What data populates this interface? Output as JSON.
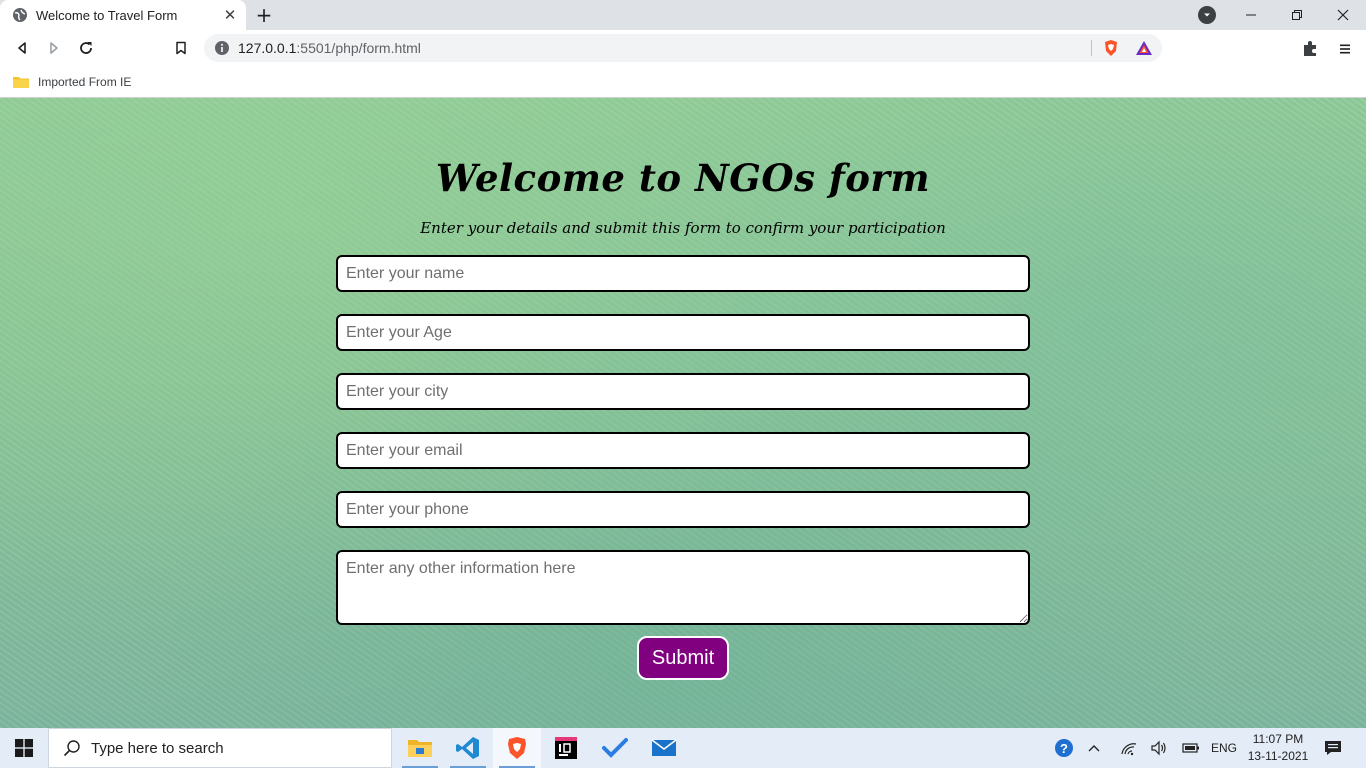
{
  "browser": {
    "tab": {
      "title": "Welcome to Travel Form"
    },
    "url": {
      "host": "127.0.0.1",
      "rest": ":5501/php/form.html"
    },
    "bookmarks": [
      {
        "label": "Imported From IE"
      }
    ]
  },
  "page": {
    "title": "Welcome to NGOs form",
    "subtitle": "Enter your details and submit this form to confirm your participation",
    "fields": [
      {
        "name": "name-input",
        "placeholder": "Enter your name",
        "value": ""
      },
      {
        "name": "age-input",
        "placeholder": "Enter your Age",
        "value": ""
      },
      {
        "name": "city-input",
        "placeholder": "Enter your city",
        "value": ""
      },
      {
        "name": "email-input",
        "placeholder": "Enter your email",
        "value": ""
      },
      {
        "name": "phone-input",
        "placeholder": "Enter your phone",
        "value": ""
      }
    ],
    "textarea": {
      "placeholder": "Enter any other information here",
      "value": ""
    },
    "submit_label": "Submit",
    "colors": {
      "submit_bg": "#800080",
      "background": "#8bc69b"
    }
  },
  "taskbar": {
    "search_placeholder": "Type here to search",
    "apps": [
      "file-explorer-icon",
      "vscode-icon",
      "brave-icon",
      "intellij-icon",
      "todo-icon",
      "mail-icon"
    ],
    "language": "ENG",
    "time": "11:07 PM",
    "date": "13-11-2021"
  }
}
